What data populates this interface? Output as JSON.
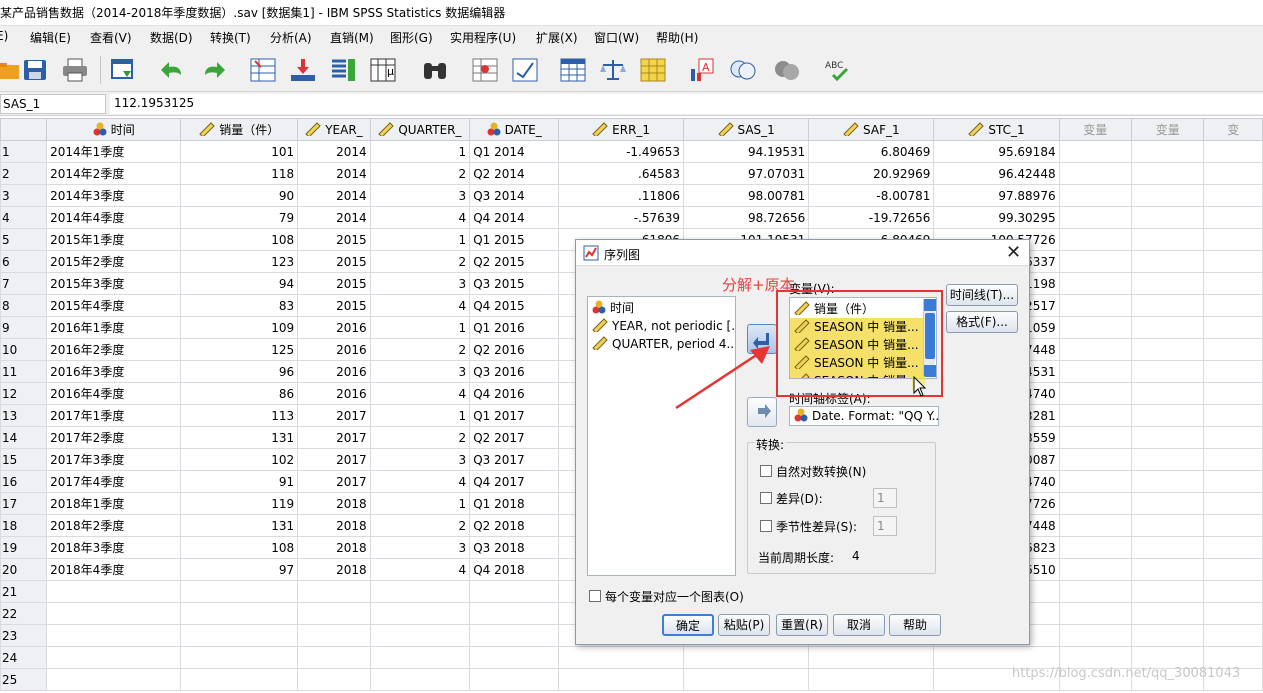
{
  "window": {
    "title": "某产品销售数据（2014-2018年季度数据）.sav [数据集1] - IBM SPSS Statistics 数据编辑器"
  },
  "menu": [
    "E)",
    "编辑(E)",
    "查看(V)",
    "数据(D)",
    "转换(T)",
    "分析(A)",
    "直销(M)",
    "图形(G)",
    "实用程序(U)",
    "扩展(X)",
    "窗口(W)",
    "帮助(H)"
  ],
  "cell": {
    "name": "SAS_1",
    "value": "112.1953125"
  },
  "columns": [
    "时间",
    "销量（件）",
    "YEAR_",
    "QUARTER_",
    "DATE_",
    "ERR_1",
    "SAS_1",
    "SAF_1",
    "STC_1",
    "变量",
    "变量",
    "变"
  ],
  "rows": [
    [
      "1",
      "2014年1季度",
      "101",
      "2014",
      "1",
      "Q1 2014",
      "-1.49653",
      "94.19531",
      "6.80469",
      "95.69184"
    ],
    [
      "2",
      "2014年2季度",
      "118",
      "2014",
      "2",
      "Q2 2014",
      ".64583",
      "97.07031",
      "20.92969",
      "96.42448"
    ],
    [
      "3",
      "2014年3季度",
      "90",
      "2014",
      "3",
      "Q3 2014",
      ".11806",
      "98.00781",
      "-8.00781",
      "97.88976"
    ],
    [
      "4",
      "2014年4季度",
      "79",
      "2014",
      "4",
      "Q4 2014",
      "-.57639",
      "98.72656",
      "-19.72656",
      "99.30295"
    ],
    [
      "5",
      "2015年1季度",
      "108",
      "2015",
      "1",
      "Q1 2015",
      ".61806",
      "101.19531",
      "6.80469",
      "100.57726"
    ],
    [
      "6",
      "2015年2季度",
      "123",
      "2015",
      "2",
      "Q2 2015",
      "",
      "",
      "",
      "1.56337"
    ],
    [
      "7",
      "2015年3季度",
      "94",
      "2015",
      "3",
      "Q3 2015",
      "",
      "",
      "",
      "2.11198"
    ],
    [
      "8",
      "2015年4季度",
      "83",
      "2015",
      "4",
      "Q4 2015",
      "",
      "",
      "",
      "2.52517"
    ],
    [
      "9",
      "2016年1季度",
      "109",
      "2016",
      "1",
      "Q1 2016",
      "",
      "",
      "",
      "2.91059"
    ],
    [
      "10",
      "2016年2季度",
      "125",
      "2016",
      "2",
      "Q2 2016",
      "",
      "",
      "",
      "3.67448"
    ],
    [
      "11",
      "2016年3季度",
      "96",
      "2016",
      "3",
      "Q3 2016",
      "",
      "",
      "",
      "4.44531"
    ],
    [
      "12",
      "2016年4季度",
      "86",
      "2016",
      "4",
      "Q4 2016",
      "",
      "",
      "",
      "5.74740"
    ],
    [
      "13",
      "2017年1季度",
      "113",
      "2017",
      "1",
      "Q1 2017",
      "",
      "",
      "",
      "7.13281"
    ],
    [
      "14",
      "2017年2季度",
      "131",
      "2017",
      "2",
      "Q2 2017",
      "",
      "",
      "",
      "3.78559"
    ],
    [
      "15",
      "2017年3季度",
      "102",
      "2017",
      "3",
      "Q3 2017",
      "",
      "",
      "",
      "0.00087"
    ],
    [
      "16",
      "2017年4季度",
      "91",
      "2017",
      "4",
      "Q4 2017",
      "",
      "",
      "",
      "0.74740"
    ],
    [
      "17",
      "2018年1季度",
      "119",
      "2018",
      "1",
      "Q1 2018",
      "",
      "",
      "",
      "1.57726"
    ],
    [
      "18",
      "2018年2季度",
      "131",
      "2018",
      "2",
      "Q2 2018",
      "",
      "",
      "",
      "2.67448"
    ],
    [
      "19",
      "2018年3季度",
      "108",
      "2018",
      "3",
      "Q3 2018",
      "",
      "",
      "",
      "4.26823"
    ],
    [
      "20",
      "2018年4季度",
      "97",
      "2018",
      "4",
      "Q4 2018",
      "",
      "",
      "",
      "5.06510"
    ],
    [
      "21",
      "",
      "",
      "",
      "",
      "",
      "",
      "",
      "",
      ""
    ],
    [
      "22",
      "",
      "",
      "",
      "",
      "",
      "",
      "",
      "",
      ""
    ],
    [
      "23",
      "",
      "",
      "",
      "",
      "",
      "",
      "",
      "",
      ""
    ],
    [
      "24",
      "",
      "",
      "",
      "",
      "",
      "",
      "",
      "",
      ""
    ],
    [
      "25",
      "",
      "",
      "",
      "",
      "",
      "",
      "",
      "",
      ""
    ]
  ],
  "dialog": {
    "title": "序列图",
    "source_vars": [
      "时间",
      "YEAR, not periodic [...",
      "QUARTER, period 4..."
    ],
    "vars_label": "变量(V):",
    "selected_vars": [
      "销量（件）",
      "SEASON 中 销量...",
      "SEASON 中 销量...",
      "SEASON 中 销量...",
      "SEASON 中 销量"
    ],
    "timeline_btn": "时间线(T)...",
    "format_btn": "格式(F)...",
    "axis_label": "时间轴标签(A):",
    "axis_value": "Date.  Format:  \"QQ Y...",
    "transform_title": "转换:",
    "natural_log": "自然对数转换(N)",
    "diff": "差异(D):",
    "seasonal_diff": "季节性差异(S):",
    "diff_val": "1",
    "seasonal_val": "1",
    "period_label": "当前周期长度:",
    "period_val": "4",
    "one_chart": "每个变量对应一个图表(O)",
    "ok": "确定",
    "paste": "粘贴(P)",
    "reset": "重置(R)",
    "cancel": "取消",
    "help": "帮助"
  },
  "annotation": "分解+原本",
  "watermark": "https://blog.csdn.net/qq_30081043"
}
